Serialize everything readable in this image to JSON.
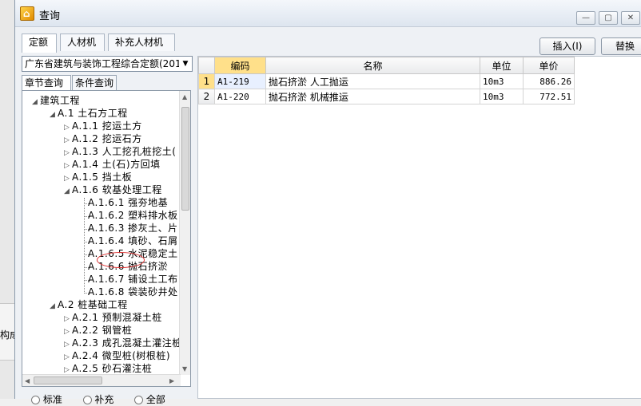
{
  "window": {
    "title": "查询"
  },
  "desktop": {
    "side_text": "构成"
  },
  "main_tabs": [
    {
      "label": "定额"
    },
    {
      "label": "人材机"
    },
    {
      "label": "补充人材机"
    }
  ],
  "toolbar": {
    "insert_label": "插入(I)",
    "replace_label": "替换"
  },
  "library": {
    "selected": "广东省建筑与装饰工程综合定额(201"
  },
  "sub_tabs": [
    {
      "label": "章节查询"
    },
    {
      "label": "条件查询"
    }
  ],
  "tree": [
    {
      "label": "建筑工程",
      "toggle": "◢"
    },
    {
      "label": "A.1 土石方工程",
      "toggle": "◢"
    },
    {
      "label": "A.1.1 挖运土方",
      "toggle": "▷"
    },
    {
      "label": "A.1.2 挖运石方",
      "toggle": "▷"
    },
    {
      "label": "A.1.3 人工挖孔桩挖土(",
      "toggle": "▷"
    },
    {
      "label": "A.1.4 土(石)方回填",
      "toggle": "▷"
    },
    {
      "label": "A.1.5 挡土板",
      "toggle": "▷"
    },
    {
      "label": "A.1.6 软基处理工程",
      "toggle": "◢"
    },
    {
      "label": "A.1.6.1 强夯地基",
      "toggle": ""
    },
    {
      "label": "A.1.6.2 塑料排水板",
      "toggle": ""
    },
    {
      "label": "A.1.6.3 掺灰土、片",
      "toggle": ""
    },
    {
      "label": "A.1.6.4 填砂、石屑",
      "toggle": ""
    },
    {
      "label": "A.1.6.5 水泥稳定土",
      "toggle": ""
    },
    {
      "label": "A.1.6.6 抛石挤淤",
      "toggle": ""
    },
    {
      "label": "A.1.6.7 铺设土工布",
      "toggle": ""
    },
    {
      "label": "A.1.6.8 袋装砂井处",
      "toggle": ""
    },
    {
      "label": "A.2 桩基础工程",
      "toggle": "◢"
    },
    {
      "label": "A.2.1 预制混凝土桩",
      "toggle": "▷"
    },
    {
      "label": "A.2.2 钢管桩",
      "toggle": "▷"
    },
    {
      "label": "A.2.3 成孔混凝土灌注桩",
      "toggle": "▷"
    },
    {
      "label": "A.2.4 微型桩(树根桩)",
      "toggle": "▷"
    },
    {
      "label": "A.2.5 砂石灌注桩",
      "toggle": "▷"
    }
  ],
  "filters": {
    "standard": "标准",
    "supplement": "补充",
    "all": "全部"
  },
  "grid": {
    "headers": [
      "编码",
      "名称",
      "单位",
      "单价"
    ],
    "rows": [
      {
        "no": "1",
        "code": "A1-219",
        "name": "抛石挤淤 人工抛运",
        "unit": "10m3",
        "price": "886.26"
      },
      {
        "no": "2",
        "code": "A1-220",
        "name": "抛石挤淤 机械推运",
        "unit": "10m3",
        "price": "772.51"
      }
    ]
  }
}
